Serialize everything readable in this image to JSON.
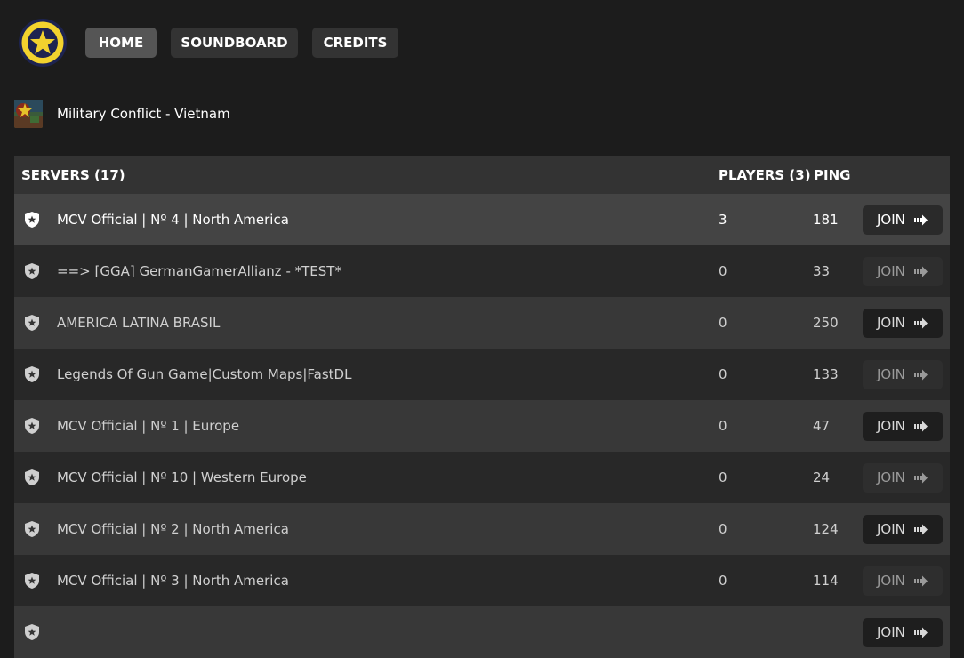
{
  "nav": {
    "logo_icon": "star-badge-icon",
    "home_label": "HOME",
    "soundboard_label": "SOUNDBOARD",
    "credits_label": "CREDITS"
  },
  "game": {
    "title": "Military Conflict - Vietnam",
    "icon": "game-thumbnail"
  },
  "table": {
    "header": {
      "servers": "SERVERS (17)",
      "players": "PLAYERS (3)",
      "ping": "PING"
    },
    "join_label": "JOIN",
    "rows": [
      {
        "name": "MCV Official | Nº 4 | North America",
        "players": "3",
        "ping": "181"
      },
      {
        "name": "==> [GGA] GermanGamerAllianz - *TEST*",
        "players": "0",
        "ping": "33"
      },
      {
        "name": "AMERICA LATINA BRASIL",
        "players": "0",
        "ping": "250"
      },
      {
        "name": "Legends Of Gun Game|Custom Maps|FastDL",
        "players": "0",
        "ping": "133"
      },
      {
        "name": "MCV Official | Nº 1 | Europe",
        "players": "0",
        "ping": "47"
      },
      {
        "name": "MCV Official | Nº 10 | Western Europe",
        "players": "0",
        "ping": "24"
      },
      {
        "name": "MCV Official | Nº 2 | North America",
        "players": "0",
        "ping": "124"
      },
      {
        "name": "MCV Official | Nº 3 | North America",
        "players": "0",
        "ping": "114"
      },
      {
        "name": "",
        "players": "",
        "ping": ""
      }
    ]
  },
  "colors": {
    "background": "#1c1c1c",
    "accent_yellow": "#f2d22e",
    "logo_navy": "#1d2350"
  }
}
